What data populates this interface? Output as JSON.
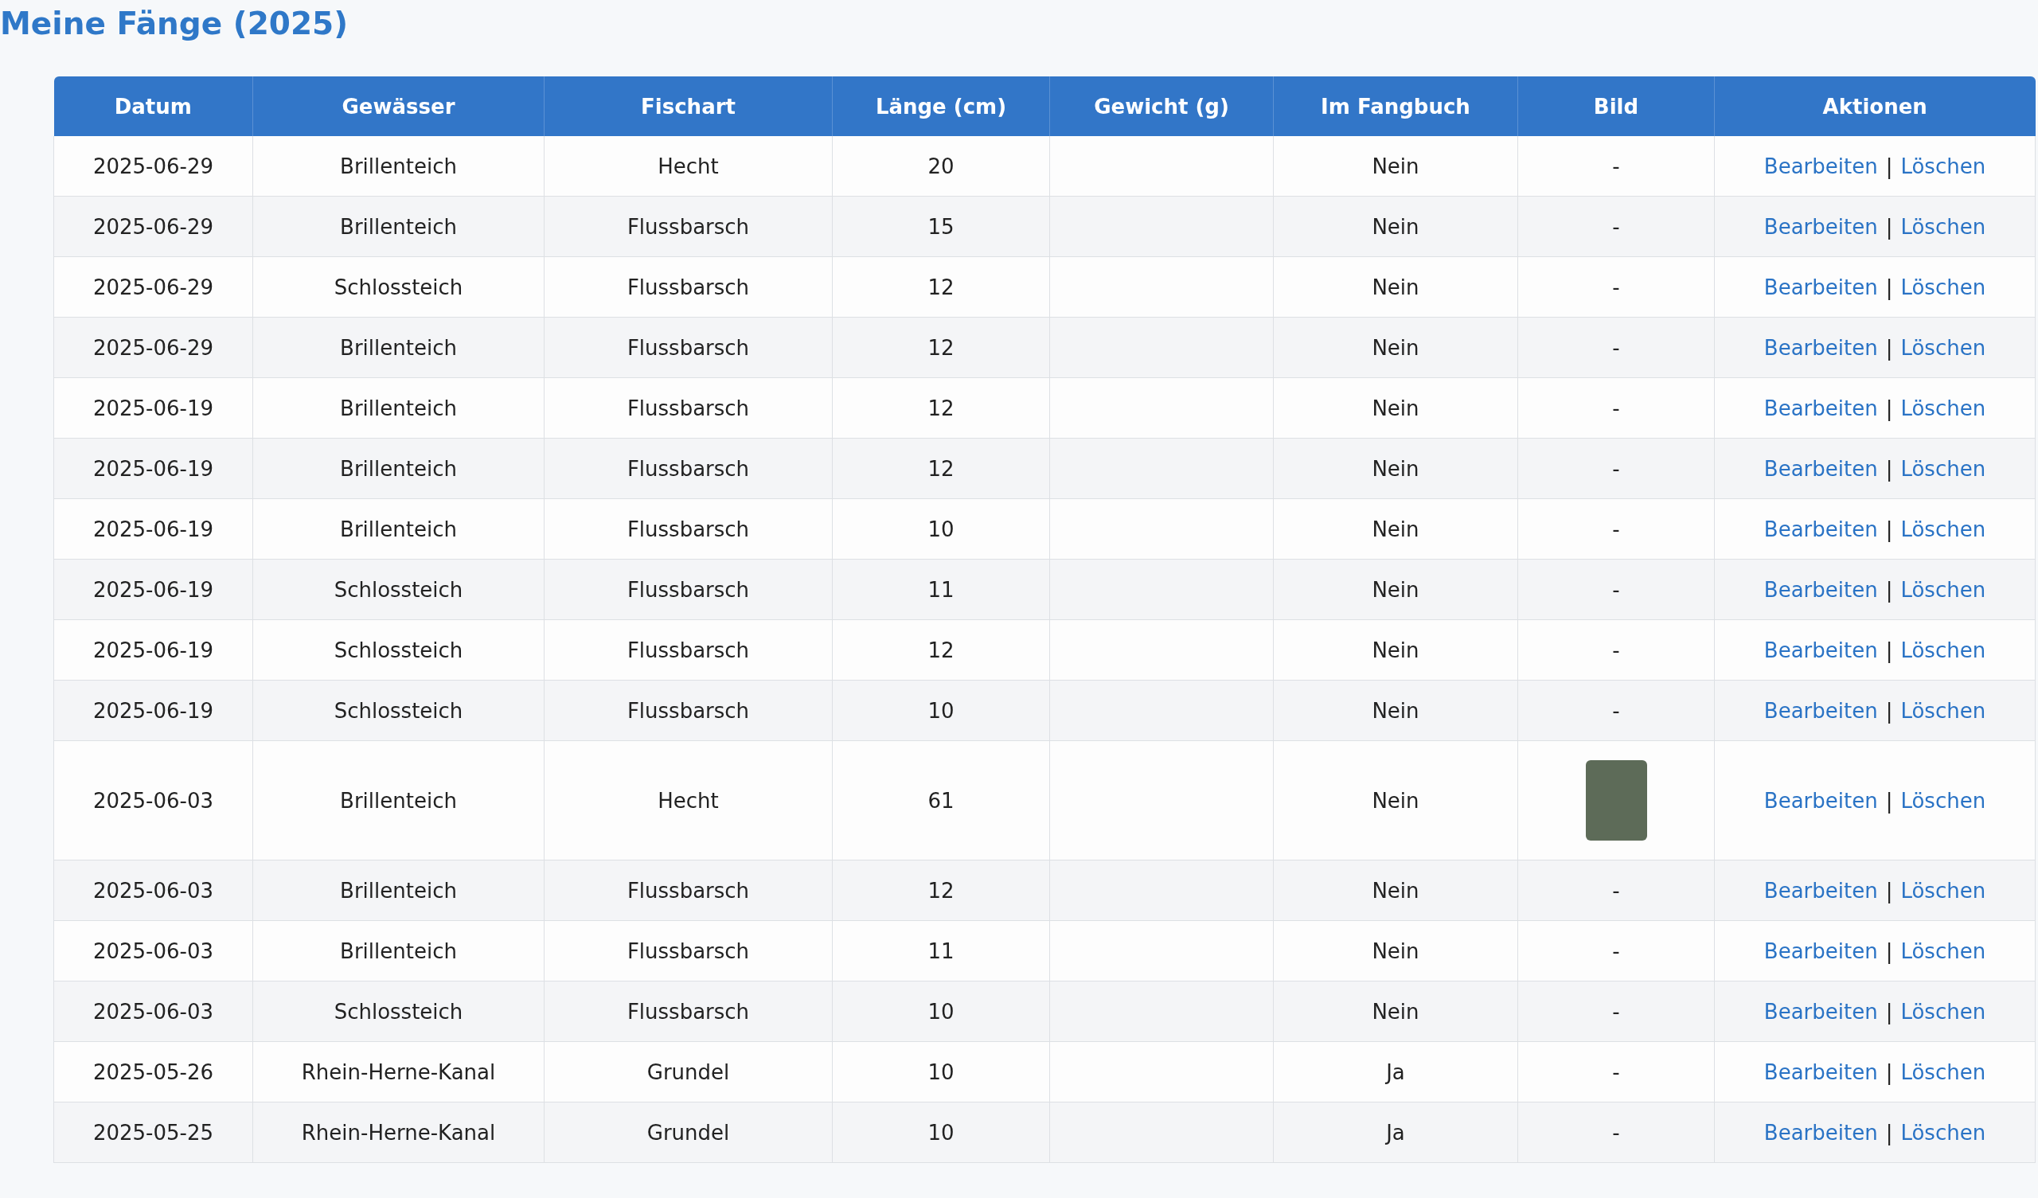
{
  "title": "Meine Fänge (2025)",
  "table": {
    "columns": [
      "Datum",
      "Gewässer",
      "Fischart",
      "Länge (cm)",
      "Gewicht (g)",
      "Im Fangbuch",
      "Bild",
      "Aktionen"
    ],
    "rows": [
      {
        "date": "2025-06-29",
        "water": "Brillenteich",
        "species": "Hecht",
        "length": "20",
        "logbook": "Nein",
        "image": {
          "kind": "text",
          "text": "-"
        },
        "actions": {
          "edit": "Bearbeiten",
          "separator": "|",
          "delete": "Löschen"
        }
      },
      {
        "date": "2025-06-29",
        "water": "Brillenteich",
        "species": "Flussbarsch",
        "length": "15",
        "logbook": "Nein",
        "image": {
          "kind": "text",
          "text": "-"
        },
        "actions": {
          "edit": "Bearbeiten",
          "separator": "|",
          "delete": "Löschen"
        }
      },
      {
        "date": "2025-06-29",
        "water": "Schlossteich",
        "species": "Flussbarsch",
        "length": "12",
        "logbook": "Nein",
        "image": {
          "kind": "text",
          "text": "-"
        },
        "actions": {
          "edit": "Bearbeiten",
          "separator": "|",
          "delete": "Löschen"
        }
      },
      {
        "date": "2025-06-29",
        "water": "Brillenteich",
        "species": "Flussbarsch",
        "length": "12",
        "logbook": "Nein",
        "image": {
          "kind": "text",
          "text": "-"
        },
        "actions": {
          "edit": "Bearbeiten",
          "separator": "|",
          "delete": "Löschen"
        }
      },
      {
        "date": "2025-06-19",
        "water": "Brillenteich",
        "species": "Flussbarsch",
        "length": "12",
        "logbook": "Nein",
        "image": {
          "kind": "text",
          "text": "-"
        },
        "actions": {
          "edit": "Bearbeiten",
          "separator": "|",
          "delete": "Löschen"
        }
      },
      {
        "date": "2025-06-19",
        "water": "Brillenteich",
        "species": "Flussbarsch",
        "length": "12",
        "logbook": "Nein",
        "image": {
          "kind": "text",
          "text": "-"
        },
        "actions": {
          "edit": "Bearbeiten",
          "separator": "|",
          "delete": "Löschen"
        }
      },
      {
        "date": "2025-06-19",
        "water": "Brillenteich",
        "species": "Flussbarsch",
        "length": "10",
        "logbook": "Nein",
        "image": {
          "kind": "text",
          "text": "-"
        },
        "actions": {
          "edit": "Bearbeiten",
          "separator": "|",
          "delete": "Löschen"
        }
      },
      {
        "date": "2025-06-19",
        "water": "Schlossteich",
        "species": "Flussbarsch",
        "length": "11",
        "logbook": "Nein",
        "image": {
          "kind": "text",
          "text": "-"
        },
        "actions": {
          "edit": "Bearbeiten",
          "separator": "|",
          "delete": "Löschen"
        }
      },
      {
        "date": "2025-06-19",
        "water": "Schlossteich",
        "species": "Flussbarsch",
        "length": "12",
        "logbook": "Nein",
        "image": {
          "kind": "text",
          "text": "-"
        },
        "actions": {
          "edit": "Bearbeiten",
          "separator": "|",
          "delete": "Löschen"
        }
      },
      {
        "date": "2025-06-19",
        "water": "Schlossteich",
        "species": "Flussbarsch",
        "length": "10",
        "logbook": "Nein",
        "image": {
          "kind": "text",
          "text": "-"
        },
        "actions": {
          "edit": "Bearbeiten",
          "separator": "|",
          "delete": "Löschen"
        }
      },
      {
        "date": "2025-06-03",
        "water": "Brillenteich",
        "species": "Hecht",
        "length": "61",
        "logbook": "Nein",
        "image": {
          "kind": "photo"
        },
        "actions": {
          "edit": "Bearbeiten",
          "separator": "|",
          "delete": "Löschen"
        }
      },
      {
        "date": "2025-06-03",
        "water": "Brillenteich",
        "species": "Flussbarsch",
        "length": "12",
        "logbook": "Nein",
        "image": {
          "kind": "text",
          "text": "-"
        },
        "actions": {
          "edit": "Bearbeiten",
          "separator": "|",
          "delete": "Löschen"
        }
      },
      {
        "date": "2025-06-03",
        "water": "Brillenteich",
        "species": "Flussbarsch",
        "length": "11",
        "logbook": "Nein",
        "image": {
          "kind": "text",
          "text": "-"
        },
        "actions": {
          "edit": "Bearbeiten",
          "separator": "|",
          "delete": "Löschen"
        }
      },
      {
        "date": "2025-06-03",
        "water": "Schlossteich",
        "species": "Flussbarsch",
        "length": "10",
        "logbook": "Nein",
        "image": {
          "kind": "text",
          "text": "-"
        },
        "actions": {
          "edit": "Bearbeiten",
          "separator": "|",
          "delete": "Löschen"
        }
      },
      {
        "date": "2025-05-26",
        "water": "Rhein-Herne-Kanal",
        "species": "Grundel",
        "length": "10",
        "logbook": "Ja",
        "image": {
          "kind": "text",
          "text": "-"
        },
        "actions": {
          "edit": "Bearbeiten",
          "separator": "|",
          "delete": "Löschen"
        }
      },
      {
        "date": "2025-05-25",
        "water": "Rhein-Herne-Kanal",
        "species": "Grundel",
        "length": "10",
        "logbook": "Ja",
        "image": {
          "kind": "text",
          "text": "-"
        },
        "actions": {
          "edit": "Bearbeiten",
          "separator": "|",
          "delete": "Löschen"
        }
      }
    ]
  }
}
